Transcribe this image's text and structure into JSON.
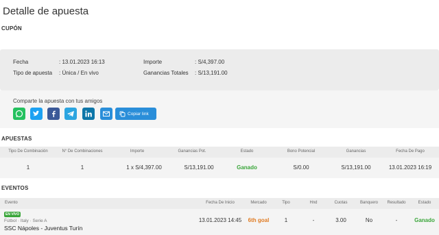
{
  "page": {
    "title": "Detalle de apuesta"
  },
  "coupon": {
    "section_label": "CUPÓN",
    "fecha_label": "Fecha",
    "fecha_value": ":  13.01.2023 16:13",
    "tipo_label": "Tipo de apuesta",
    "tipo_value": ":  Única / En vivo",
    "importe_label": "Importe",
    "importe_value": ":  S/4,397.00",
    "ganancias_label": "Ganancias Totales",
    "ganancias_value": ":  S/13,191.00"
  },
  "share": {
    "label": "Comparte la apuesta con tus amigos",
    "copy_label": "Copiar link",
    "colors": {
      "whatsapp": "#25c15f",
      "twitter": "#1da1f2",
      "facebook": "#3b5998",
      "telegram": "#2ca5e0",
      "linkedin": "#0e76a8",
      "email": "#2a8ed9"
    }
  },
  "bets": {
    "section_label": "APUESTAS",
    "headers": [
      "Tipo De Combinación",
      "N° De Combinaciones",
      "Importe",
      "Ganancias Pot.",
      "Estado",
      "Bono Potencial",
      "Ganancias",
      "Fecha De Pago"
    ],
    "row": [
      "1",
      "1",
      "1 x S/4,397.00",
      "S/13,191.00",
      "Ganado",
      "S/0.00",
      "S/13,191.00",
      "13.01.2023 16:19"
    ]
  },
  "events": {
    "section_label": "EVENTOS",
    "headers": [
      "Evento",
      "Fecha De Inicio",
      "Mercado",
      "Tipo",
      "Hnd",
      "Cuotas",
      "Banquero",
      "Resultado",
      "Estado"
    ],
    "live_badge": "EN VIVO",
    "league": "Fútbol · Italy · Serie A",
    "match": "SSC Nápoles - Juventus Turín",
    "row": [
      "13.01.2023 14:45",
      "6th goal",
      "1",
      "-",
      "3.00",
      "No",
      "-",
      "Ganado"
    ]
  },
  "status_color": "#3aa63a",
  "market_color": "#e07b22"
}
